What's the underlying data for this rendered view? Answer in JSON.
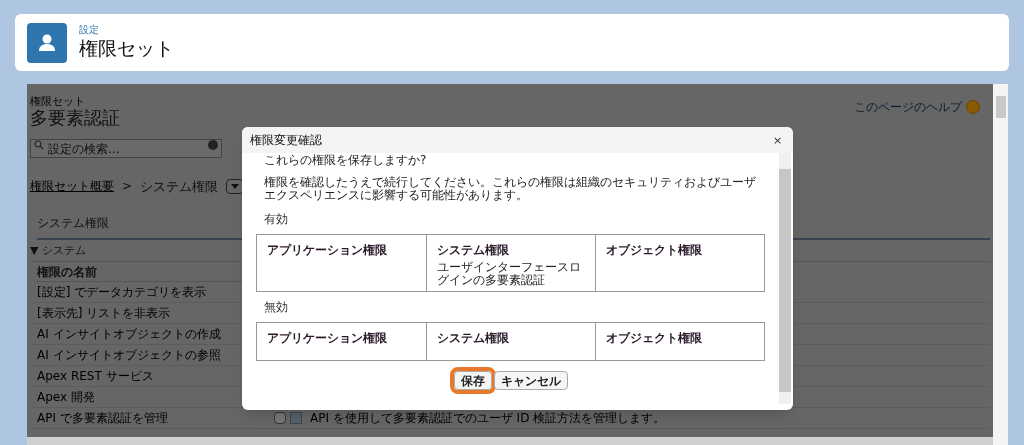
{
  "header": {
    "breadcrumb": "設定",
    "title": "権限セット"
  },
  "page": {
    "subtitle": "権限セット",
    "title": "多要素認証",
    "help_link": "このページのヘルプ",
    "search": {
      "placeholder": "設定の検索..."
    },
    "breadcrumb": {
      "link": "権限セット概要",
      "separator": ">",
      "current": "システム権限"
    },
    "section_title": "システム権限",
    "group": {
      "toggle": "▼",
      "label": "システム"
    },
    "table": {
      "column": "権限の名前",
      "rows": [
        {
          "name": "[設定] でデータカテゴリを表示"
        },
        {
          "name": "[表示先] リストを非表示"
        },
        {
          "name": "AI インサイトオブジェクトの作成"
        },
        {
          "name": "AI インサイトオブジェクトの参照"
        },
        {
          "name": "Apex REST サービス"
        },
        {
          "name": "Apex 開発"
        },
        {
          "name": "API で多要素認証を管理",
          "checked": false,
          "description": "API を使用して多要素認証でのユーザ ID 検証方法を管理します。"
        }
      ]
    }
  },
  "dialog": {
    "title": "権限変更確認",
    "close": "×",
    "question": "これらの権限を保存しますか?",
    "message": "権限を確認したうえで続行してください。これらの権限は組織のセキュリティおよびユーザエクスペリエンスに影響する可能性があります。",
    "sections": [
      {
        "label": "有効",
        "columns": [
          {
            "header": "アプリケーション権限"
          },
          {
            "header": "システム権限",
            "items": [
              "ユーザインターフェースログインの多要素認証"
            ]
          },
          {
            "header": "オブジェクト権限"
          }
        ]
      },
      {
        "label": "無効",
        "columns": [
          {
            "header": "アプリケーション権限"
          },
          {
            "header": "システム権限"
          },
          {
            "header": "オブジェクト権限"
          }
        ]
      }
    ],
    "buttons": [
      {
        "label": "保存",
        "focused": true
      },
      {
        "label": "キャンセル",
        "focused": false
      }
    ]
  }
}
